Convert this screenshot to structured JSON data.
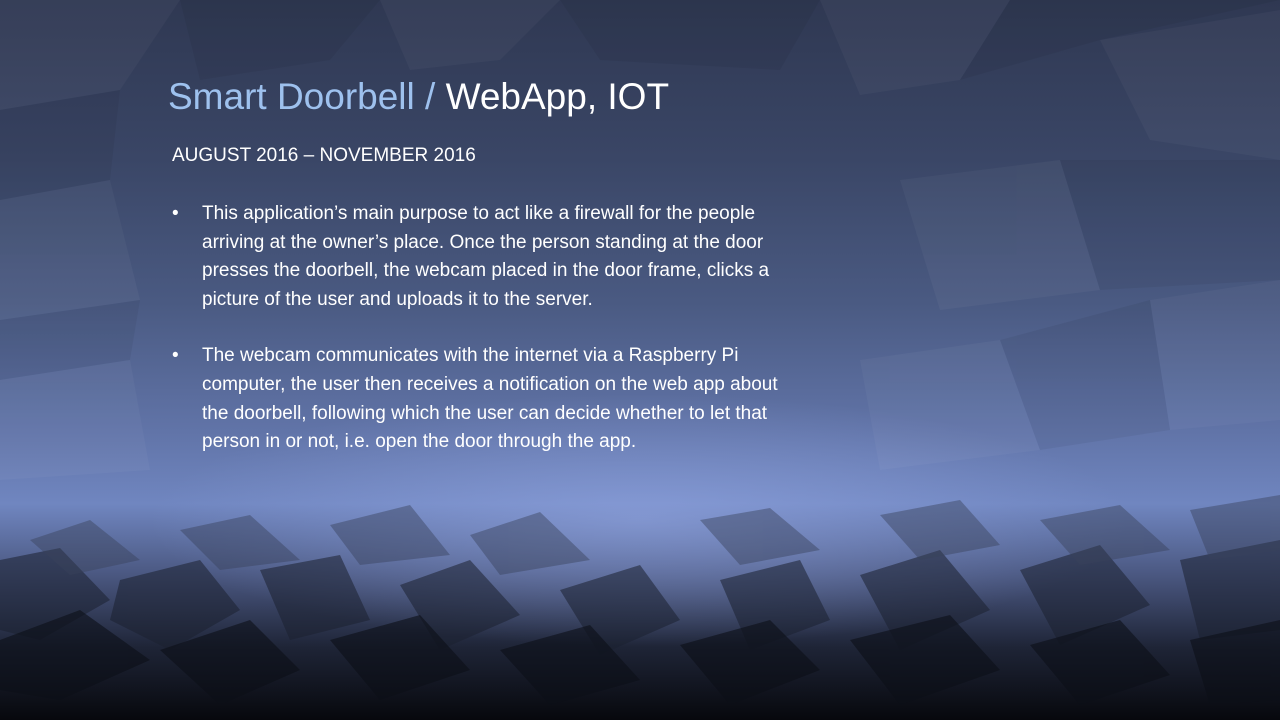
{
  "slide": {
    "title_part1": "Smart Doorbell / ",
    "title_part2": "WebApp, IOT",
    "date_range": "AUGUST 2016 – NOVEMBER 2016",
    "bullet_glyph": "•",
    "bullets": [
      "This application’s main purpose to act like a firewall for the people arriving at the owner’s place. Once the person standing at the door presses the doorbell, the webcam placed in the door frame, clicks a picture of the user and uploads it to the server.",
      "The webcam communicates with the internet via a Raspberry Pi computer, the user then receives a notification on the web app about the doorbell, following which the user can decide whether to let that person in or not, i.e. open the door through the app."
    ]
  },
  "colors": {
    "title_accent": "#9ec1ee",
    "text": "#ffffff",
    "background_top": "#2f3852",
    "background_glow": "#7086c0",
    "background_bottom": "#07080d"
  }
}
